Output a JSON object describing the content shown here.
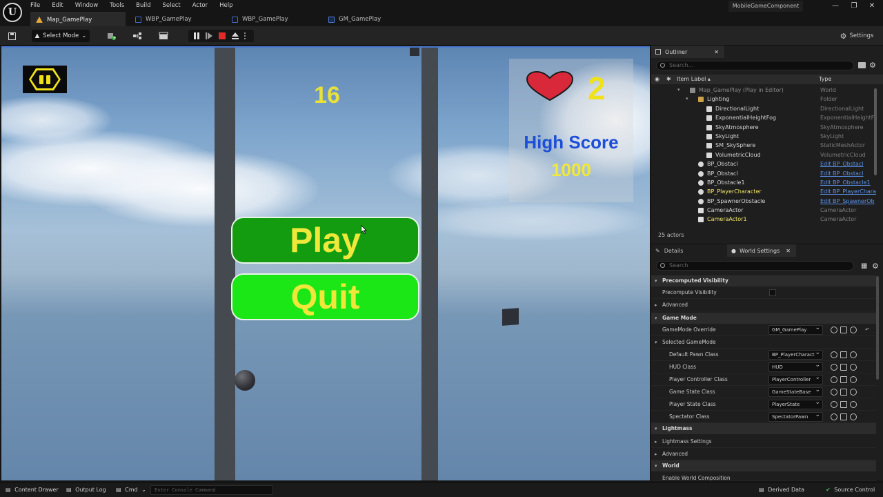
{
  "app": {
    "logo": "unreal-logo",
    "menu": [
      "File",
      "Edit",
      "Window",
      "Tools",
      "Build",
      "Select",
      "Actor",
      "Help"
    ],
    "project_name": "MobileGameComponent",
    "tabs": [
      {
        "label": "Map_GamePlay",
        "icon": "level-icon",
        "active": true
      },
      {
        "label": "WBP_GamePlay",
        "icon": "widget-blueprint-icon",
        "active": false
      },
      {
        "label": "WBP_GamePlay",
        "icon": "widget-blueprint-icon",
        "active": false
      },
      {
        "label": "GM_GamePlay",
        "icon": "blueprint-icon",
        "active": false
      }
    ]
  },
  "toolbar": {
    "select_mode": "Select Mode",
    "settings": "Settings"
  },
  "viewport": {
    "score": "16",
    "lives": "2",
    "high_score_label": "High Score",
    "high_score_value": "1000",
    "play_label": "Play",
    "quit_label": "Quit"
  },
  "outliner": {
    "tab": "Outliner",
    "search_placeholder": "Search...",
    "col_label": "Item Label ▴",
    "col_type": "Type",
    "rows": [
      {
        "label": "Map_GamePlay (Play in Editor)",
        "type": "World",
        "indent": 0,
        "link": false
      },
      {
        "label": "Lighting",
        "type": "Folder",
        "indent": 1,
        "link": false
      },
      {
        "label": "DirectionalLight",
        "type": "DirectionalLight",
        "indent": 2,
        "link": false
      },
      {
        "label": "ExponentialHeightFog",
        "type": "ExponentialHeightFo",
        "indent": 2,
        "link": false
      },
      {
        "label": "SkyAtmosphere",
        "type": "SkyAtmosphere",
        "indent": 2,
        "link": false
      },
      {
        "label": "SkyLight",
        "type": "SkyLight",
        "indent": 2,
        "link": false
      },
      {
        "label": "SM_SkySphere",
        "type": "StaticMeshActor",
        "indent": 2,
        "link": false
      },
      {
        "label": "VolumetricCloud",
        "type": "VolumetricCloud",
        "indent": 2,
        "link": false
      },
      {
        "label": "BP_Obstacl",
        "type": "Edit BP_Obstacl",
        "indent": 1,
        "link": true
      },
      {
        "label": "BP_Obstacl",
        "type": "Edit BP_Obstacl",
        "indent": 1,
        "link": true
      },
      {
        "label": "BP_Obstacle1",
        "type": "Edit BP_Obstacle1",
        "indent": 1,
        "link": true
      },
      {
        "label": "BP_PlayerCharacter",
        "type": "Edit BP_PlayerChara",
        "indent": 1,
        "link": true,
        "highlight": true
      },
      {
        "label": "BP_SpawnerObstacle",
        "type": "Edit BP_SpawnerOb",
        "indent": 1,
        "link": true
      },
      {
        "label": "CameraActor",
        "type": "CameraActor",
        "indent": 1,
        "link": false
      },
      {
        "label": "CameraActor1",
        "type": "CameraActor",
        "indent": 1,
        "link": false,
        "highlight": true
      }
    ],
    "actor_count": "25 actors"
  },
  "details": {
    "tab_details": "Details",
    "tab_world_settings": "World Settings",
    "search_placeholder": "Search",
    "sections": {
      "precomputed_visibility": "Precomputed Visibility",
      "precompute_visibility": "Precompute Visibility",
      "advanced": "Advanced",
      "game_mode": "Game Mode",
      "gamemode_override": "GameMode Override",
      "gamemode_override_value": "GM_GamePlay",
      "selected_gamemode": "Selected GameMode",
      "lightmass": "Lightmass",
      "lightmass_settings": "Lightmass Settings",
      "advanced2": "Advanced",
      "world": "World",
      "enable_world_composition": "Enable World Composition"
    },
    "gamemode_props": [
      {
        "label": "Default Pawn Class",
        "value": "BP_PlayerCharact"
      },
      {
        "label": "HUD Class",
        "value": "HUD"
      },
      {
        "label": "Player Controller Class",
        "value": "PlayerController"
      },
      {
        "label": "Game State Class",
        "value": "GameStateBase"
      },
      {
        "label": "Player State Class",
        "value": "PlayerState"
      },
      {
        "label": "Spectator Class",
        "value": "SpectatorPawn"
      }
    ]
  },
  "statusbar": {
    "content_drawer": "Content Drawer",
    "output_log": "Output Log",
    "cmd": "Cmd",
    "console_placeholder": "Enter Console Command",
    "derived_data": "Derived Data",
    "source_control": "Source Control"
  },
  "colors": {
    "accent": "#4a78d0",
    "play_button": "#139c10",
    "quit_button": "#1be717",
    "score_yellow": "#e9e13a",
    "high_score_blue": "#1e4ed8",
    "link_blue": "#5c90e8"
  }
}
